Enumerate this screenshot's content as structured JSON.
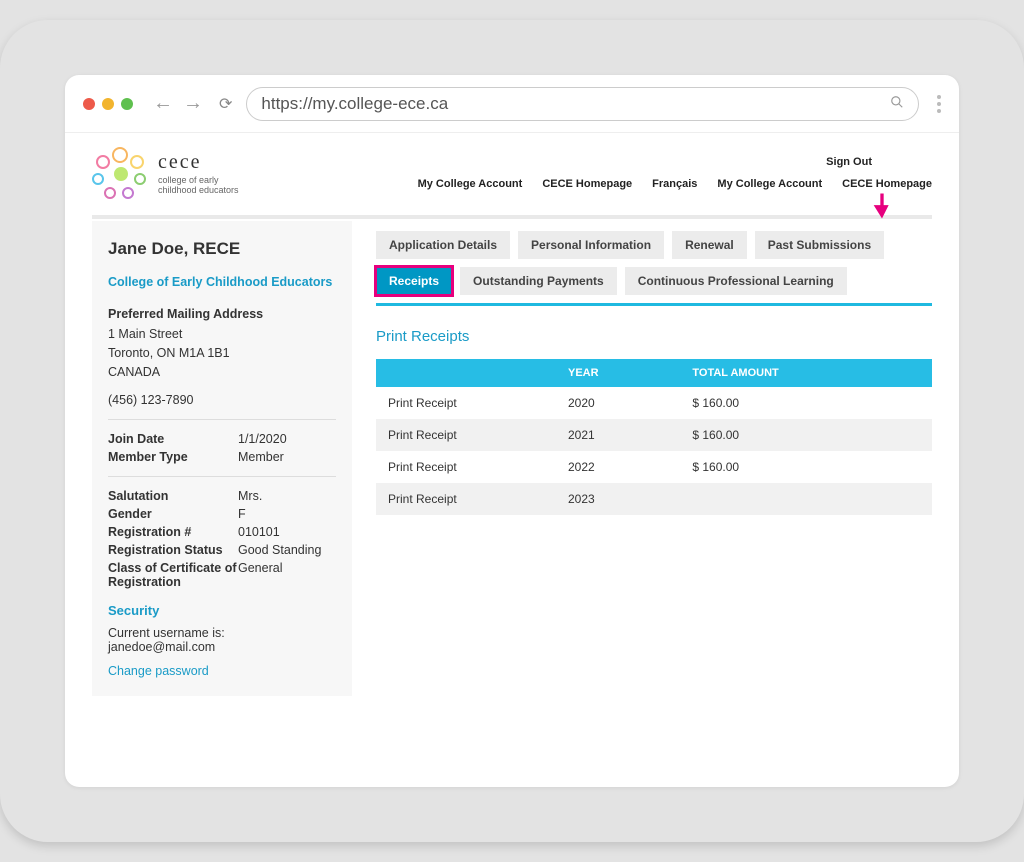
{
  "browser": {
    "url": "https://my.college-ece.ca"
  },
  "brand": {
    "name": "cece",
    "subtitle": "college of early childhood educators"
  },
  "topnav": {
    "signout": "Sign Out",
    "links": [
      "My College Account",
      "CECE Homepage",
      "Français",
      "My College Account",
      "CECE Homepage"
    ]
  },
  "sidebar": {
    "member_name": "Jane Doe, RECE",
    "org_link": "College of Early Childhood Educators",
    "address_heading": "Preferred Mailing Address",
    "address_line1": "1 Main Street",
    "address_line2": "Toronto, ON  M1A 1B1",
    "address_country": "CANADA",
    "phone": "(456) 123-7890",
    "join_date_label": "Join Date",
    "join_date": "1/1/2020",
    "member_type_label": "Member Type",
    "member_type": "Member",
    "salutation_label": "Salutation",
    "salutation": "Mrs.",
    "gender_label": "Gender",
    "gender": "F",
    "regnum_label": "Registration #",
    "regnum": "010101",
    "regstatus_label": "Registration Status",
    "regstatus": "Good Standing",
    "class_label": "Class of Certificate of Registration",
    "class_value": "General",
    "security_heading": "Security",
    "username_label": "Current username is:",
    "username": "janedoe@mail.com",
    "change_password": "Change password"
  },
  "tabs": {
    "items": [
      "Application Details",
      "Personal Information",
      "Renewal",
      "Past Submissions",
      "Receipts",
      "Outstanding Payments",
      "Continuous Professional Learning"
    ],
    "active_index": 4
  },
  "receipts": {
    "title": "Print Receipts",
    "col_empty": "",
    "col_year": "YEAR",
    "col_total": "TOTAL AMOUNT",
    "rows": [
      {
        "action": "Print Receipt",
        "year": "2020",
        "amount": "$ 160.00"
      },
      {
        "action": "Print Receipt",
        "year": "2021",
        "amount": "$ 160.00"
      },
      {
        "action": "Print Receipt",
        "year": "2022",
        "amount": "$ 160.00"
      },
      {
        "action": "Print Receipt",
        "year": "2023",
        "amount": ""
      }
    ]
  }
}
